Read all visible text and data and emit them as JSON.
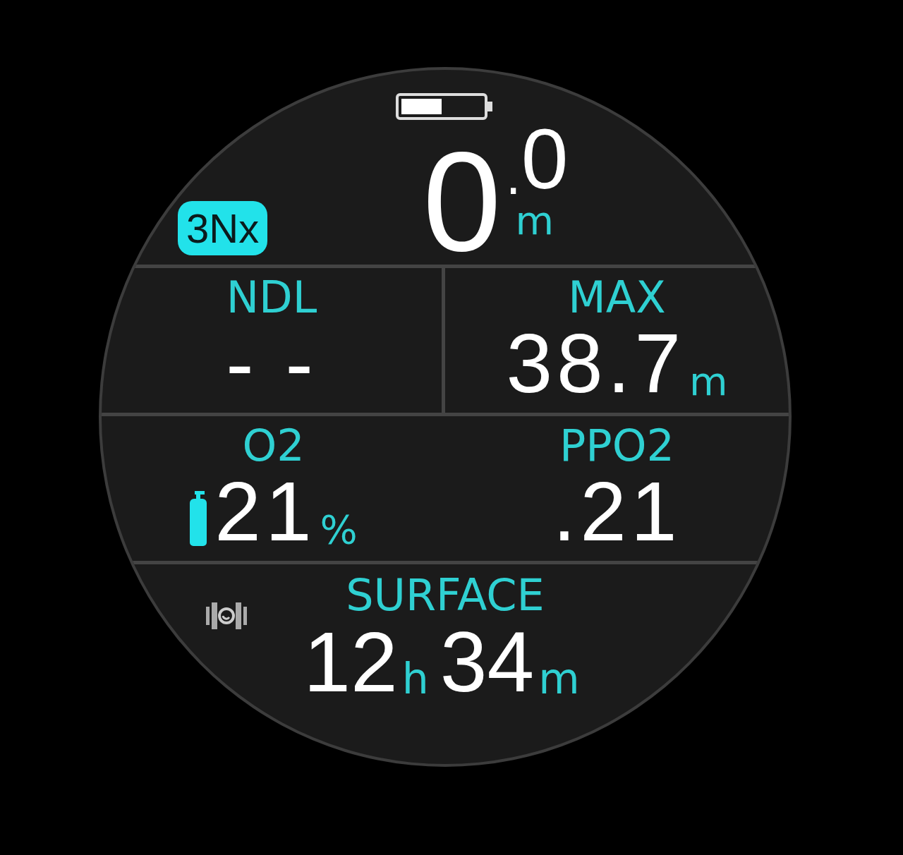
{
  "battery": {
    "level": 0.5
  },
  "gas_badge": "3Nx",
  "depth": {
    "whole": "0",
    "separator": ".",
    "decimal": "0",
    "unit": "m"
  },
  "rows": [
    {
      "cells": [
        {
          "kind": "plain",
          "label": "NDL",
          "value": "- -"
        },
        {
          "kind": "plain",
          "label": "MAX",
          "value": "38.7",
          "unit": "m"
        }
      ],
      "divided": true
    },
    {
      "cells": [
        {
          "kind": "gas",
          "label": "O2",
          "value": "21",
          "unit": "%"
        },
        {
          "kind": "plain",
          "label": "PPO2",
          "value": ".21"
        }
      ],
      "divided": false
    }
  ],
  "surface": {
    "label": "SURFACE",
    "parts": [
      {
        "value": "12",
        "unit": "h"
      },
      {
        "value": "34",
        "unit": "m"
      }
    ]
  }
}
